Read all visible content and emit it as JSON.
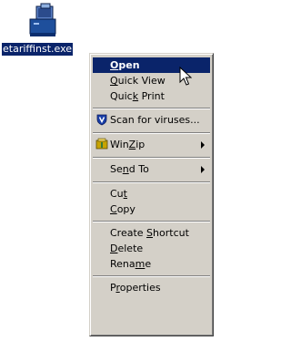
{
  "desktop_icon": {
    "label": "etariffinst.exe",
    "icon": "installer-computer-icon"
  },
  "context_menu": {
    "items": [
      {
        "id": "open",
        "label": "Open",
        "default": true,
        "highlighted": true
      },
      {
        "id": "quick-view",
        "label": "Quick View"
      },
      {
        "id": "quick-print",
        "label": "Quick Print"
      },
      {
        "id": "scan-for-viruses",
        "label": "Scan for viruses...",
        "icon": "antivirus-shield-icon"
      },
      {
        "id": "winzip",
        "label": "WinZip",
        "icon": "winzip-icon",
        "submenu": true
      },
      {
        "id": "send-to",
        "label": "Send To",
        "submenu": true
      },
      {
        "id": "cut",
        "label": "Cut"
      },
      {
        "id": "copy",
        "label": "Copy"
      },
      {
        "id": "create-shortcut",
        "label": "Create Shortcut"
      },
      {
        "id": "delete",
        "label": "Delete"
      },
      {
        "id": "rename",
        "label": "Rename"
      },
      {
        "id": "properties",
        "label": "Properties"
      }
    ]
  },
  "colors": {
    "menu_background": "#d4d0c8",
    "highlight": "#0a246a",
    "highlight_text": "#ffffff"
  }
}
